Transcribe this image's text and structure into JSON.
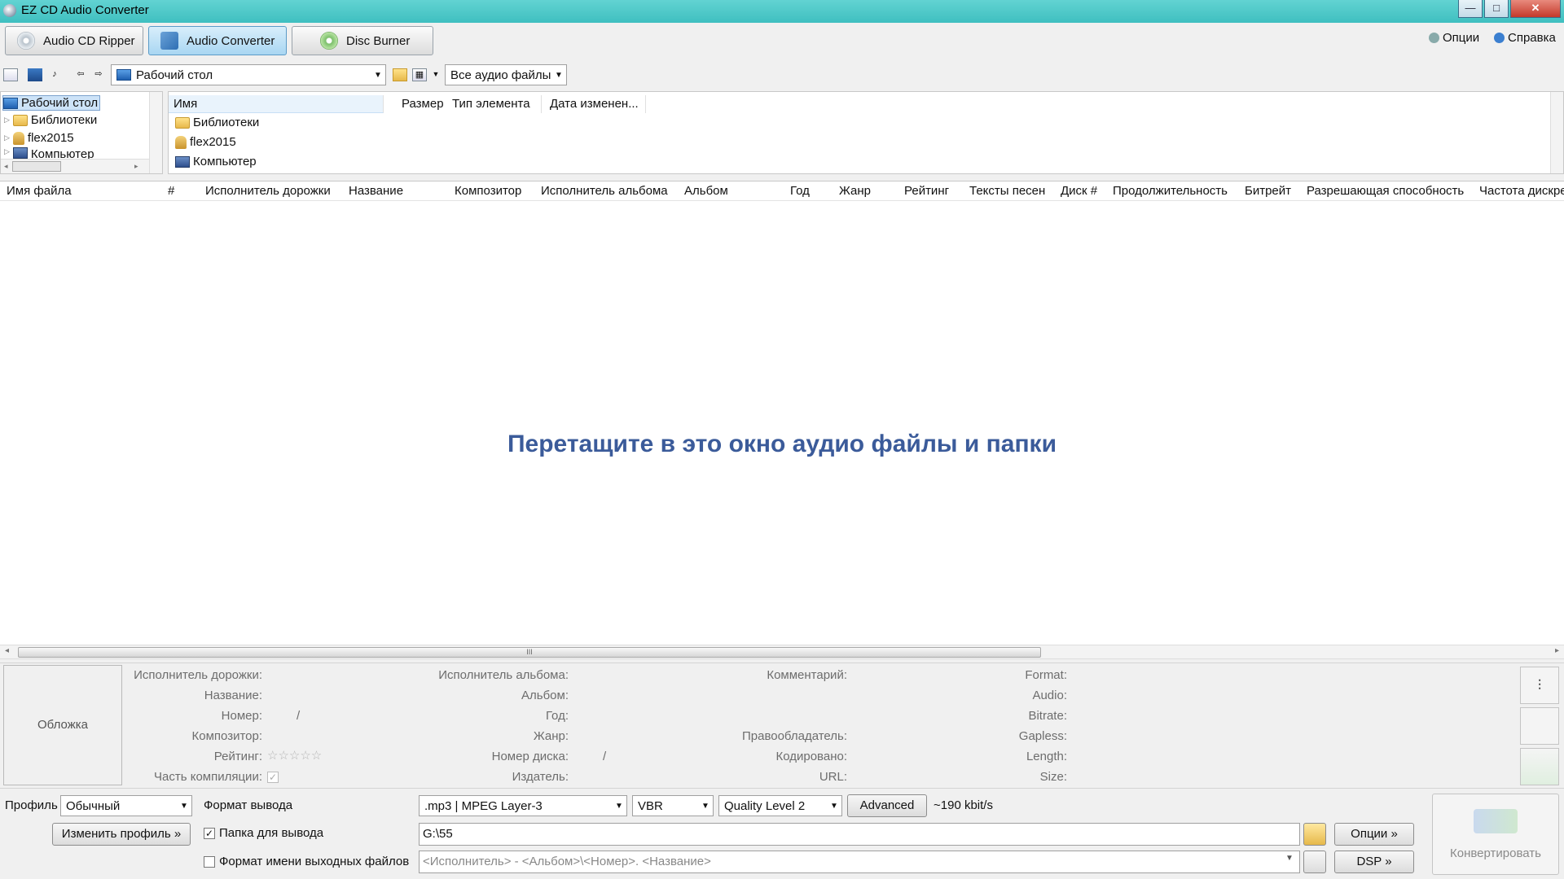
{
  "window": {
    "title": "EZ CD Audio Converter",
    "controls": {
      "minimize": "—",
      "maximize": "□",
      "close": "✕"
    }
  },
  "modes": [
    {
      "label": "Audio CD Ripper",
      "active": false
    },
    {
      "label": "Audio Converter",
      "active": true
    },
    {
      "label": "Disc Burner",
      "active": false
    }
  ],
  "top_links": {
    "options": "Опции",
    "help": "Справка"
  },
  "toolbar": {
    "location": "Рабочий стол",
    "filter": "Все аудио файлы"
  },
  "tree": {
    "items": [
      "Рабочий стол",
      "Библиотеки",
      "flex2015",
      "Компьютер"
    ]
  },
  "explorer": {
    "columns": [
      "Имя",
      "Размер",
      "Тип элемента",
      "Дата изменен..."
    ],
    "rows": [
      "Библиотеки",
      "flex2015",
      "Компьютер"
    ]
  },
  "file_table": {
    "columns": [
      "Имя файла",
      "#",
      "Исполнитель дорожки",
      "Название",
      "Композитор",
      "Исполнитель альбома",
      "Альбом",
      "Год",
      "Жанр",
      "Рейтинг",
      "Тексты песен",
      "Диск #",
      "Продолжительность",
      "Битрейт",
      "Разрешающая способность",
      "Частота дискре"
    ],
    "empty_message": "Перетащите в это окно аудио файлы и папки",
    "scroll_grip": "III"
  },
  "tags": {
    "cover": "Обложка",
    "col1": [
      "Исполнитель дорожки:",
      "Название:",
      "Номер:",
      "Композитор:",
      "Рейтинг:",
      "Часть компиляции:"
    ],
    "col2": [
      "Исполнитель альбома:",
      "Альбом:",
      "Год:",
      "Жанр:",
      "Номер диска:",
      "Издатель:"
    ],
    "col3": [
      "Комментарий:",
      "Правообладатель:",
      "Кодировано:",
      "URL:"
    ],
    "col4": [
      "Format:",
      "Audio:",
      "Bitrate:",
      "Gapless:",
      "Length:",
      "Size:"
    ],
    "slash": "/",
    "stars": "☆☆☆☆☆"
  },
  "bottom": {
    "profile_label": "Профиль",
    "profile_value": "Обычный",
    "edit_profile": "Изменить профиль »",
    "output_format_label": "Формат вывода",
    "format": ".mp3 | MPEG Layer-3",
    "mode": "VBR",
    "quality": "Quality Level 2",
    "advanced": "Advanced",
    "bitrate_text": "~190 kbit/s",
    "output_folder_label": "Папка для вывода",
    "output_folder": "G:\\55",
    "options_btn": "Опции »",
    "filename_format_label": "Формат имени выходных файлов",
    "filename_format": "<Исполнитель> - <Альбом>\\<Номер>. <Название>",
    "dsp_btn": "DSP »",
    "convert_btn": "Конвертировать"
  },
  "colors": {
    "titlebar": "#4ac5c5",
    "accent": "#3b5b9a"
  }
}
